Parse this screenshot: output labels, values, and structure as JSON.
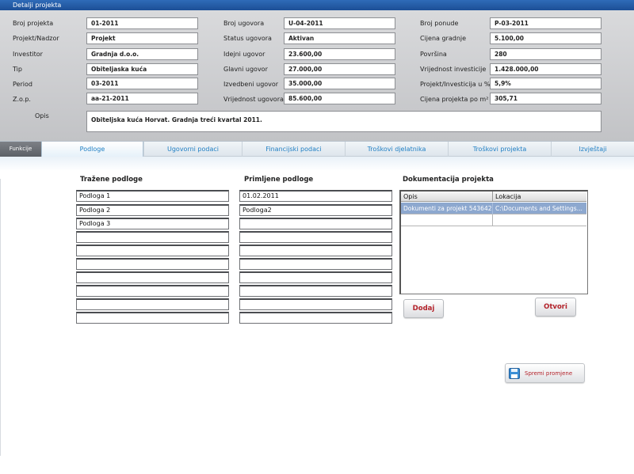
{
  "window": {
    "title": "Detalji projekta"
  },
  "header": {
    "col1": [
      {
        "label": "Broj projekta",
        "value": "01-2011"
      },
      {
        "label": "Projekt/Nadzor",
        "value": "Projekt"
      },
      {
        "label": "Investitor",
        "value": "Gradnja d.o.o."
      },
      {
        "label": "Tip",
        "value": "Obiteljaska kuća"
      },
      {
        "label": "Period",
        "value": "03-2011"
      },
      {
        "label": "Z.o.p.",
        "value": "aa-21-2011"
      }
    ],
    "col2": [
      {
        "label": "Broj ugovora",
        "value": "U-04-2011"
      },
      {
        "label": "Status ugovora",
        "value": "Aktivan"
      },
      {
        "label": "Idejni ugovor",
        "value": "23.600,00"
      },
      {
        "label": "Glavni ugovor",
        "value": "27.000,00"
      },
      {
        "label": "Izvedbeni ugovor",
        "value": "35.000,00"
      },
      {
        "label": "Vrijednost ugovora",
        "value": "85.600,00"
      }
    ],
    "col3": [
      {
        "label": "Broj ponude",
        "value": "P-03-2011"
      },
      {
        "label": "Cijena gradnje",
        "value": "5.100,00"
      },
      {
        "label": "Površina",
        "value": "280"
      },
      {
        "label": "Vrijednost investicije",
        "value": "1.428.000,00"
      },
      {
        "label": "Projekt/Investicija u %",
        "value": "5,9%"
      },
      {
        "label": "Cijena projekta po m²",
        "value": "305,71"
      }
    ],
    "opis": {
      "label": "Opis",
      "value": "Obiteljska kuća Horvat. Gradnja treći kvartal 2011."
    }
  },
  "tabs": {
    "functions_label": "Funkcije",
    "items": [
      "Podloge",
      "Ugovorni podaci",
      "Financijski podaci",
      "Troškovi djelatnika",
      "Troškovi projekta",
      "Izvještaji"
    ],
    "active": "Podloge"
  },
  "podloge": {
    "trazene_title": "Tražene podloge",
    "trazene": [
      "Podloga 1",
      "Podloga 2",
      "Podloga 3",
      "",
      "",
      "",
      "",
      "",
      "",
      ""
    ],
    "primljene_title": "Primljene podloge",
    "primljene": [
      "01.02.2011",
      "Podloga2",
      "",
      "",
      "",
      "",
      "",
      "",
      "",
      ""
    ]
  },
  "dokumentacija": {
    "title": "Dokumentacija projekta",
    "columns": [
      "Opis",
      "Lokacija"
    ],
    "rows": [
      {
        "opis": "Dokumenti za projekt 543642",
        "lokacija": "C:\\Documents and Settings..."
      },
      {
        "opis": "",
        "lokacija": ""
      }
    ],
    "add_label": "Dodaj",
    "open_label": "Otvori"
  },
  "save": {
    "label": "Spremi promjene"
  },
  "colors": {
    "accent_blue": "#1f7fc4",
    "button_text": "#b3222a",
    "selection": "#8da8cf"
  }
}
